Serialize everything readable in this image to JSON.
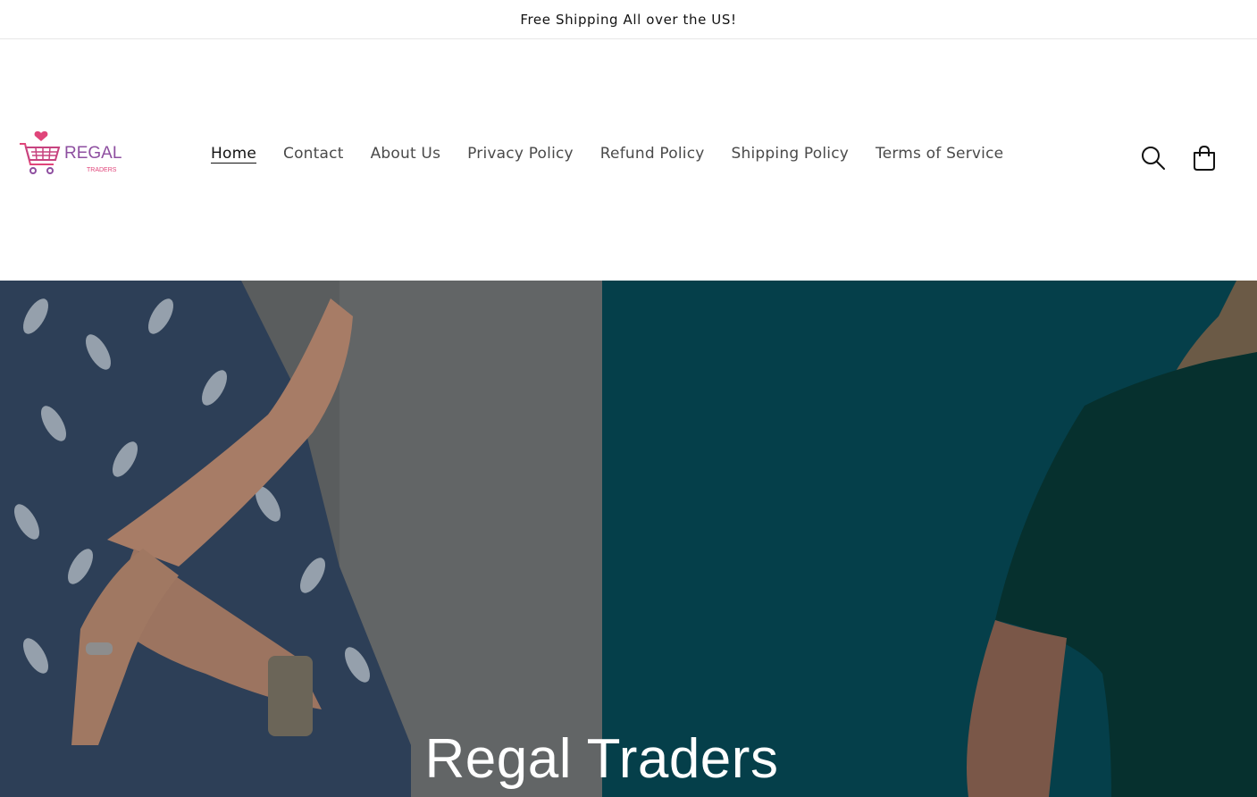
{
  "announcement": {
    "text": "Free Shipping All over the US!"
  },
  "brand": {
    "logo_word": "REGAL",
    "logo_sub": "TRADERS",
    "primary_color": "#8e4fa0",
    "accent_color": "#e0457a"
  },
  "nav": {
    "items": [
      {
        "label": "Home",
        "active": true
      },
      {
        "label": "Contact"
      },
      {
        "label": "About Us"
      },
      {
        "label": "Privacy Policy"
      },
      {
        "label": "Refund Policy"
      },
      {
        "label": "Shipping Policy"
      },
      {
        "label": "Terms of Service"
      }
    ]
  },
  "header_icons": {
    "search": "search-icon",
    "cart": "cart-icon"
  },
  "hero": {
    "title": "Regal Traders",
    "left_bg": "#555859",
    "right_bg": "#053f4a"
  }
}
